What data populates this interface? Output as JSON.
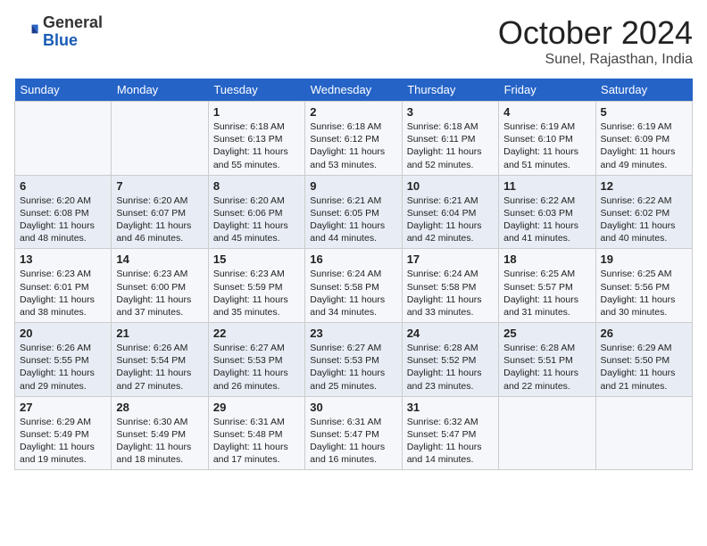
{
  "header": {
    "logo_general": "General",
    "logo_blue": "Blue",
    "month_title": "October 2024",
    "location": "Sunel, Rajasthan, India"
  },
  "days_of_week": [
    "Sunday",
    "Monday",
    "Tuesday",
    "Wednesday",
    "Thursday",
    "Friday",
    "Saturday"
  ],
  "weeks": [
    [
      {
        "day": "",
        "content": ""
      },
      {
        "day": "",
        "content": ""
      },
      {
        "day": "1",
        "content": "Sunrise: 6:18 AM\nSunset: 6:13 PM\nDaylight: 11 hours and 55 minutes."
      },
      {
        "day": "2",
        "content": "Sunrise: 6:18 AM\nSunset: 6:12 PM\nDaylight: 11 hours and 53 minutes."
      },
      {
        "day": "3",
        "content": "Sunrise: 6:18 AM\nSunset: 6:11 PM\nDaylight: 11 hours and 52 minutes."
      },
      {
        "day": "4",
        "content": "Sunrise: 6:19 AM\nSunset: 6:10 PM\nDaylight: 11 hours and 51 minutes."
      },
      {
        "day": "5",
        "content": "Sunrise: 6:19 AM\nSunset: 6:09 PM\nDaylight: 11 hours and 49 minutes."
      }
    ],
    [
      {
        "day": "6",
        "content": "Sunrise: 6:20 AM\nSunset: 6:08 PM\nDaylight: 11 hours and 48 minutes."
      },
      {
        "day": "7",
        "content": "Sunrise: 6:20 AM\nSunset: 6:07 PM\nDaylight: 11 hours and 46 minutes."
      },
      {
        "day": "8",
        "content": "Sunrise: 6:20 AM\nSunset: 6:06 PM\nDaylight: 11 hours and 45 minutes."
      },
      {
        "day": "9",
        "content": "Sunrise: 6:21 AM\nSunset: 6:05 PM\nDaylight: 11 hours and 44 minutes."
      },
      {
        "day": "10",
        "content": "Sunrise: 6:21 AM\nSunset: 6:04 PM\nDaylight: 11 hours and 42 minutes."
      },
      {
        "day": "11",
        "content": "Sunrise: 6:22 AM\nSunset: 6:03 PM\nDaylight: 11 hours and 41 minutes."
      },
      {
        "day": "12",
        "content": "Sunrise: 6:22 AM\nSunset: 6:02 PM\nDaylight: 11 hours and 40 minutes."
      }
    ],
    [
      {
        "day": "13",
        "content": "Sunrise: 6:23 AM\nSunset: 6:01 PM\nDaylight: 11 hours and 38 minutes."
      },
      {
        "day": "14",
        "content": "Sunrise: 6:23 AM\nSunset: 6:00 PM\nDaylight: 11 hours and 37 minutes."
      },
      {
        "day": "15",
        "content": "Sunrise: 6:23 AM\nSunset: 5:59 PM\nDaylight: 11 hours and 35 minutes."
      },
      {
        "day": "16",
        "content": "Sunrise: 6:24 AM\nSunset: 5:58 PM\nDaylight: 11 hours and 34 minutes."
      },
      {
        "day": "17",
        "content": "Sunrise: 6:24 AM\nSunset: 5:58 PM\nDaylight: 11 hours and 33 minutes."
      },
      {
        "day": "18",
        "content": "Sunrise: 6:25 AM\nSunset: 5:57 PM\nDaylight: 11 hours and 31 minutes."
      },
      {
        "day": "19",
        "content": "Sunrise: 6:25 AM\nSunset: 5:56 PM\nDaylight: 11 hours and 30 minutes."
      }
    ],
    [
      {
        "day": "20",
        "content": "Sunrise: 6:26 AM\nSunset: 5:55 PM\nDaylight: 11 hours and 29 minutes."
      },
      {
        "day": "21",
        "content": "Sunrise: 6:26 AM\nSunset: 5:54 PM\nDaylight: 11 hours and 27 minutes."
      },
      {
        "day": "22",
        "content": "Sunrise: 6:27 AM\nSunset: 5:53 PM\nDaylight: 11 hours and 26 minutes."
      },
      {
        "day": "23",
        "content": "Sunrise: 6:27 AM\nSunset: 5:53 PM\nDaylight: 11 hours and 25 minutes."
      },
      {
        "day": "24",
        "content": "Sunrise: 6:28 AM\nSunset: 5:52 PM\nDaylight: 11 hours and 23 minutes."
      },
      {
        "day": "25",
        "content": "Sunrise: 6:28 AM\nSunset: 5:51 PM\nDaylight: 11 hours and 22 minutes."
      },
      {
        "day": "26",
        "content": "Sunrise: 6:29 AM\nSunset: 5:50 PM\nDaylight: 11 hours and 21 minutes."
      }
    ],
    [
      {
        "day": "27",
        "content": "Sunrise: 6:29 AM\nSunset: 5:49 PM\nDaylight: 11 hours and 19 minutes."
      },
      {
        "day": "28",
        "content": "Sunrise: 6:30 AM\nSunset: 5:49 PM\nDaylight: 11 hours and 18 minutes."
      },
      {
        "day": "29",
        "content": "Sunrise: 6:31 AM\nSunset: 5:48 PM\nDaylight: 11 hours and 17 minutes."
      },
      {
        "day": "30",
        "content": "Sunrise: 6:31 AM\nSunset: 5:47 PM\nDaylight: 11 hours and 16 minutes."
      },
      {
        "day": "31",
        "content": "Sunrise: 6:32 AM\nSunset: 5:47 PM\nDaylight: 11 hours and 14 minutes."
      },
      {
        "day": "",
        "content": ""
      },
      {
        "day": "",
        "content": ""
      }
    ]
  ]
}
